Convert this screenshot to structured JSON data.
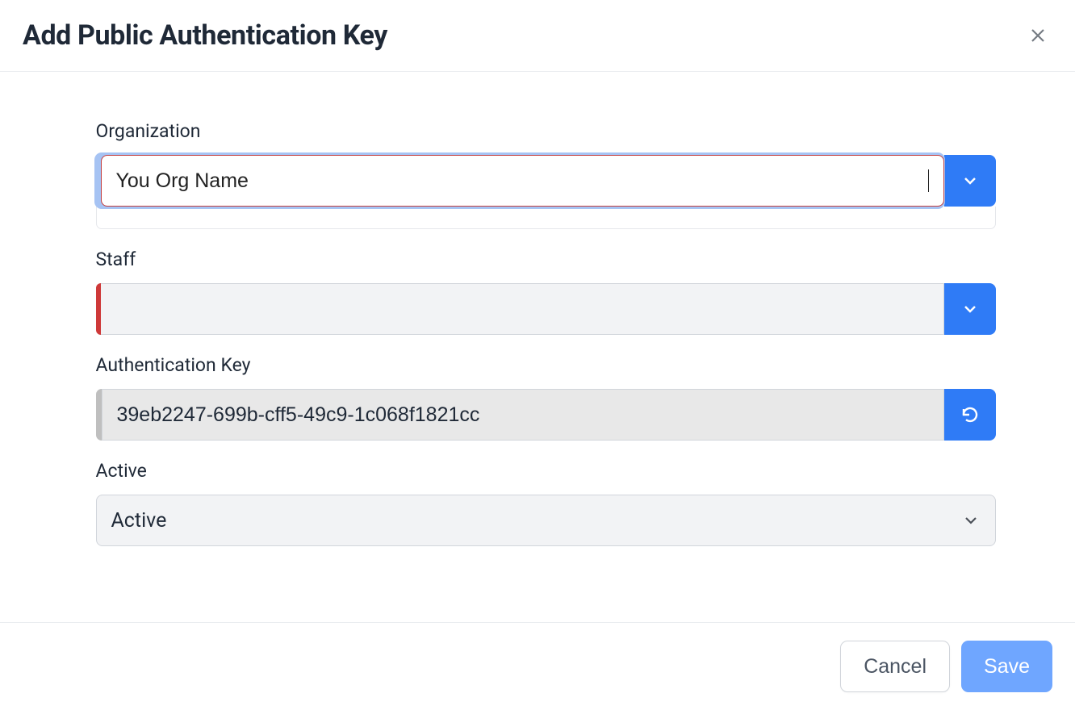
{
  "dialog": {
    "title": "Add Public Authentication Key",
    "close_label": "Close"
  },
  "fields": {
    "organization": {
      "label": "Organization",
      "value": "You Org Name"
    },
    "staff": {
      "label": "Staff",
      "value": ""
    },
    "auth_key": {
      "label": "Authentication Key",
      "value": "39eb2247-699b-cff5-49c9-1c068f1821cc"
    },
    "active": {
      "label": "Active",
      "value": "Active"
    }
  },
  "footer": {
    "cancel": "Cancel",
    "save": "Save"
  }
}
